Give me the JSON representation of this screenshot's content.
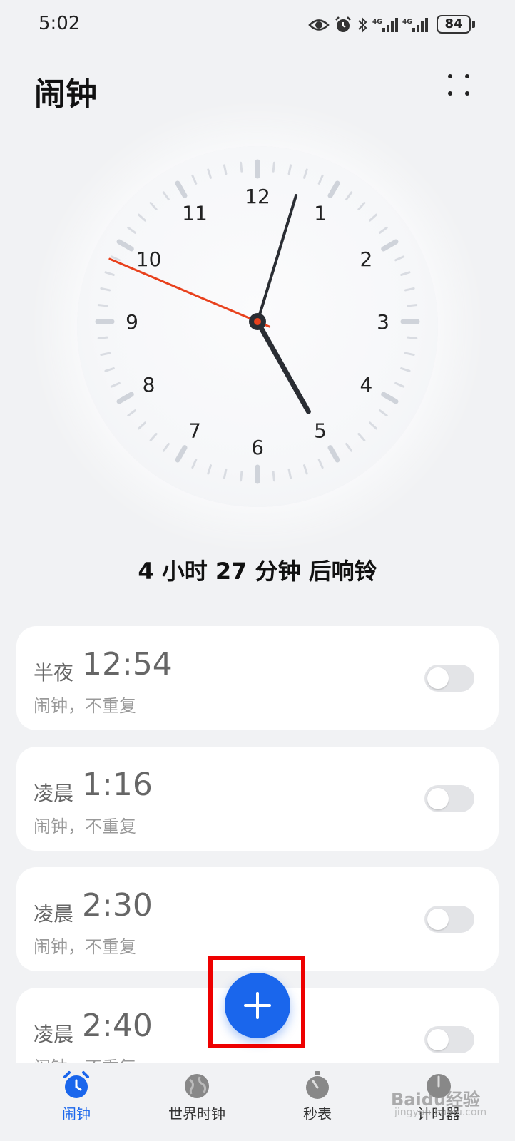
{
  "status_bar": {
    "time": "5:02",
    "battery": "84"
  },
  "header": {
    "title": "闹钟"
  },
  "clock": {
    "numbers": [
      "12",
      "1",
      "2",
      "3",
      "4",
      "5",
      "6",
      "7",
      "8",
      "9",
      "10",
      "11"
    ],
    "time_shown": "5:02",
    "colors": {
      "second_hand": "#e8411d",
      "hands": "#2a2d33"
    }
  },
  "next_alarm": "4 小时 27 分钟 后响铃",
  "alarms": [
    {
      "period": "半夜",
      "time": "12:54",
      "sub": "闹钟，不重复",
      "enabled": false
    },
    {
      "period": "凌晨",
      "time": "1:16",
      "sub": "闹钟，不重复",
      "enabled": false
    },
    {
      "period": "凌晨",
      "time": "2:30",
      "sub": "闹钟，不重复",
      "enabled": false
    },
    {
      "period": "凌晨",
      "time": "2:40",
      "sub": "闹钟，不重复",
      "enabled": false
    }
  ],
  "bottom_nav": [
    {
      "label": "闹钟",
      "icon": "alarm-clock-icon",
      "active": true
    },
    {
      "label": "世界时钟",
      "icon": "globe-icon",
      "active": false
    },
    {
      "label": "秒表",
      "icon": "stopwatch-icon",
      "active": false
    },
    {
      "label": "计时器",
      "icon": "timer-icon",
      "active": false
    }
  ],
  "watermark": {
    "text": "Baidu经验",
    "sub": "jingyan.baidu.com"
  },
  "accent_color": "#1a66ec"
}
